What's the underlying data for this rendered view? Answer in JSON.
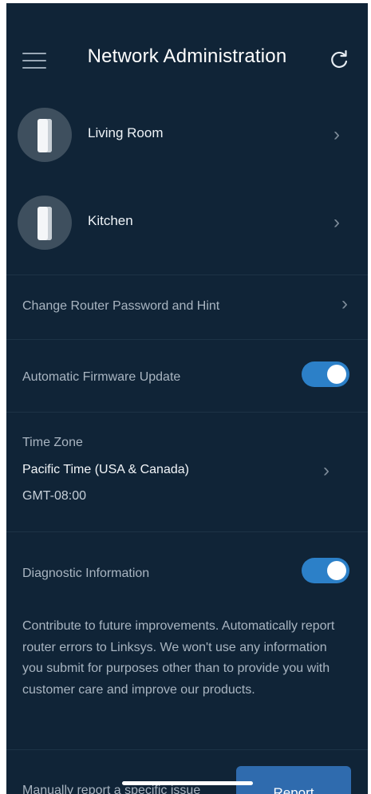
{
  "header": {
    "title": "Network Administration"
  },
  "nodes": [
    {
      "label": "Living Room"
    },
    {
      "label": "Kitchen"
    }
  ],
  "router_password": {
    "label": "Change Router Password and Hint"
  },
  "firmware": {
    "label": "Automatic Firmware Update",
    "enabled": true
  },
  "timezone": {
    "heading": "Time Zone",
    "value": "Pacific Time (USA & Canada)",
    "offset": "GMT-08:00"
  },
  "diagnostics": {
    "label": "Diagnostic Information",
    "enabled": true,
    "description": "Contribute to future improvements. Automatically report router errors to Linksys. We won't use any information you submit for purposes other than to provide you with customer care and improve our products."
  },
  "footer": {
    "manual_report_text": "Manually report a specific issue",
    "report_button": "Report"
  },
  "colors": {
    "background": "#102437",
    "toggle_on": "#2c80c8",
    "button": "#2f6bae"
  }
}
